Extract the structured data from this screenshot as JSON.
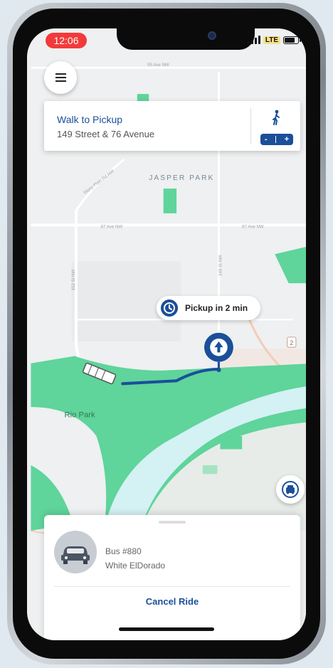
{
  "status_bar": {
    "time": "12:06",
    "network": "LTE"
  },
  "walk_card": {
    "title": "Walk to Pickup",
    "address": "149 Street & 76 Avenue",
    "zoom_minus": "-",
    "zoom_plus": "+"
  },
  "map": {
    "area_label": "JASPER PARK",
    "park_label": "Rio Park",
    "street_87": "87 Ave NW",
    "street_95": "95 Ave NW",
    "street_v1": "152 St NW",
    "street_v2": "149 St NW",
    "street_diag": "Stony Plain Rd NW",
    "road_badge": "2",
    "route_color": "#1b4f9a",
    "park_color": "#5fd49b",
    "water_color": "#d4f1f4"
  },
  "pickup_eta": "Pickup in 2 min",
  "ride": {
    "bus": "Bus #880",
    "vehicle": "White ElDorado",
    "cancel_label": "Cancel Ride"
  },
  "icons": {
    "menu": "menu-icon",
    "walk": "walking-person-icon",
    "clock": "clock-icon",
    "pickup_pin": "pickup-pin-icon",
    "bus_marker": "bus-icon",
    "recenter": "recenter-car-icon",
    "vehicle": "car-icon"
  }
}
